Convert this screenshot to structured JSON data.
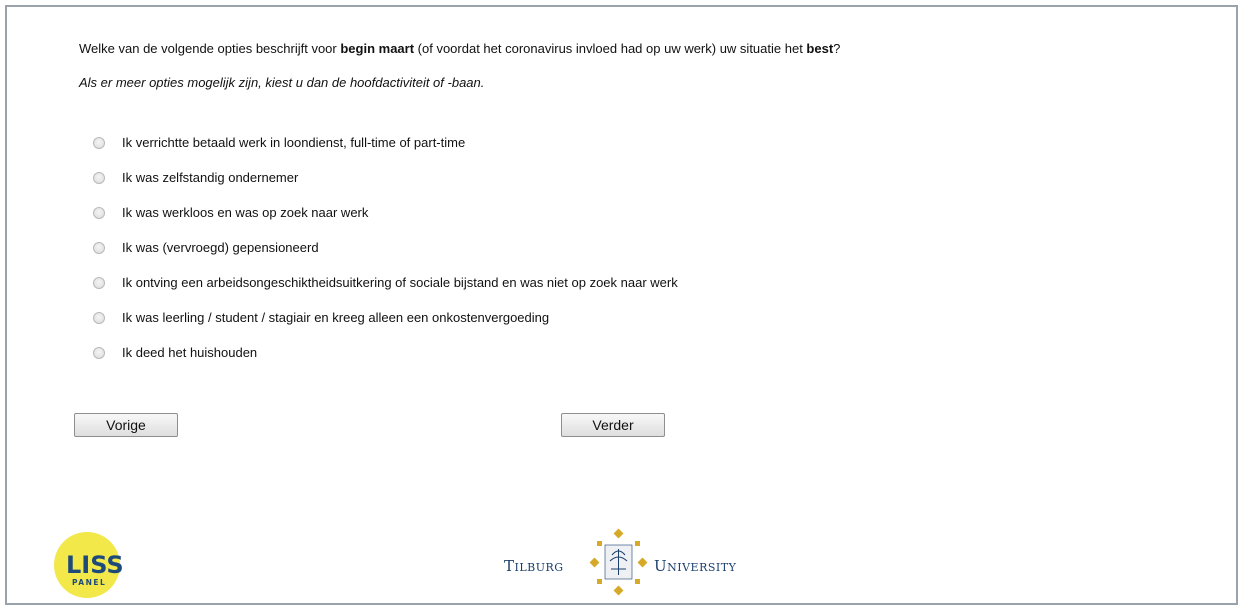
{
  "question": {
    "prefix": "Welke van de volgende opties beschrijft voor ",
    "bold1": "begin maart",
    "middle": " (of voordat het coronavirus invloed had op uw werk) uw situatie het ",
    "bold2": "best",
    "suffix": "?"
  },
  "instruction": "Als er meer opties mogelijk zijn, kiest u dan de hoofdactiviteit of -baan.",
  "options": [
    "Ik verrichtte betaald werk in loondienst, full-time of part-time",
    "Ik was zelfstandig ondernemer",
    "Ik was werkloos en was op zoek naar werk",
    "Ik was (vervroegd) gepensioneerd",
    "Ik ontving een arbeidsongeschiktheidsuitkering of sociale bijstand en was niet op zoek naar werk",
    "Ik was leerling / student / stagiair en kreeg alleen een onkostenvergoeding",
    "Ik deed het huishouden"
  ],
  "buttons": {
    "previous": "Vorige",
    "next": "Verder"
  },
  "logos": {
    "liss": {
      "line1": "LISS",
      "line2": "PANEL"
    },
    "tilburg": {
      "left": "Tilburg",
      "right": "University"
    }
  },
  "colors": {
    "liss_yellow": "#f2e84a",
    "liss_text": "#1d4a7a",
    "tilburg_blue": "#1c3f6e",
    "tilburg_gold": "#d7a928"
  }
}
